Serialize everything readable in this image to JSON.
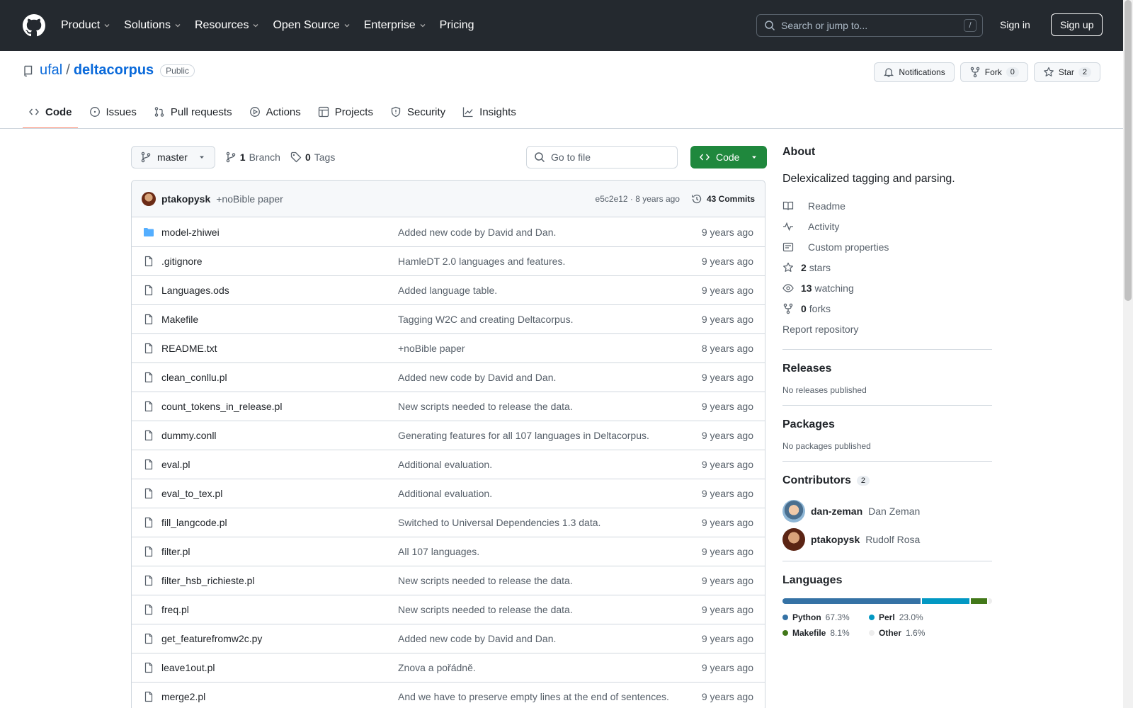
{
  "header": {
    "nav": [
      "Product",
      "Solutions",
      "Resources",
      "Open Source",
      "Enterprise",
      "Pricing"
    ],
    "search_placeholder": "Search or jump to...",
    "search_shortcut": "/",
    "signin": "Sign in",
    "signup": "Sign up"
  },
  "repo": {
    "owner": "ufal",
    "separator": "/",
    "name": "deltacorpus",
    "visibility": "Public",
    "notifications_label": "Notifications",
    "fork_label": "Fork",
    "fork_count": "0",
    "star_label": "Star",
    "star_count": "2"
  },
  "tabs": [
    "Code",
    "Issues",
    "Pull requests",
    "Actions",
    "Projects",
    "Security",
    "Insights"
  ],
  "toolbar": {
    "branch": "master",
    "branch_count": "1",
    "branch_label": "Branch",
    "tag_count": "0",
    "tag_label": "Tags",
    "goto_placeholder": "Go to file",
    "code_label": "Code"
  },
  "latest_commit": {
    "author": "ptakopysk",
    "message": "+noBible paper",
    "sha_age": "e5c2e12 · 8 years ago",
    "commits": "43 Commits"
  },
  "files": [
    {
      "name": "model-zhiwei",
      "type": "dir",
      "message": "Added new code by David and Dan.",
      "age": "9 years ago"
    },
    {
      "name": ".gitignore",
      "type": "file",
      "message": "HamleDT 2.0 languages and features.",
      "age": "9 years ago"
    },
    {
      "name": "Languages.ods",
      "type": "file",
      "message": "Added language table.",
      "age": "9 years ago"
    },
    {
      "name": "Makefile",
      "type": "file",
      "message": "Tagging W2C and creating Deltacorpus.",
      "age": "9 years ago"
    },
    {
      "name": "README.txt",
      "type": "file",
      "message": "+noBible paper",
      "age": "8 years ago"
    },
    {
      "name": "clean_conllu.pl",
      "type": "file",
      "message": "Added new code by David and Dan.",
      "age": "9 years ago"
    },
    {
      "name": "count_tokens_in_release.pl",
      "type": "file",
      "message": "New scripts needed to release the data.",
      "age": "9 years ago"
    },
    {
      "name": "dummy.conll",
      "type": "file",
      "message": "Generating features for all 107 languages in Deltacorpus.",
      "age": "9 years ago"
    },
    {
      "name": "eval.pl",
      "type": "file",
      "message": "Additional evaluation.",
      "age": "9 years ago"
    },
    {
      "name": "eval_to_tex.pl",
      "type": "file",
      "message": "Additional evaluation.",
      "age": "9 years ago"
    },
    {
      "name": "fill_langcode.pl",
      "type": "file",
      "message": "Switched to Universal Dependencies 1.3 data.",
      "age": "9 years ago"
    },
    {
      "name": "filter.pl",
      "type": "file",
      "message": "All 107 languages.",
      "age": "9 years ago"
    },
    {
      "name": "filter_hsb_richieste.pl",
      "type": "file",
      "message": "New scripts needed to release the data.",
      "age": "9 years ago"
    },
    {
      "name": "freq.pl",
      "type": "file",
      "message": "New scripts needed to release the data.",
      "age": "9 years ago"
    },
    {
      "name": "get_featurefromw2c.py",
      "type": "file",
      "message": "Added new code by David and Dan.",
      "age": "9 years ago"
    },
    {
      "name": "leave1out.pl",
      "type": "file",
      "message": "Znova a pořádně.",
      "age": "9 years ago"
    },
    {
      "name": "merge2.pl",
      "type": "file",
      "message": "And we have to preserve empty lines at the end of sentences.",
      "age": "9 years ago"
    }
  ],
  "about": {
    "title": "About",
    "description": "Delexicalized tagging and parsing.",
    "links": [
      {
        "icon": "book-icon",
        "bold": "",
        "text": "Readme"
      },
      {
        "icon": "pulse-icon",
        "bold": "",
        "text": "Activity"
      },
      {
        "icon": "note-icon",
        "bold": "",
        "text": "Custom properties"
      },
      {
        "icon": "star-icon",
        "bold": "2",
        "text": "stars"
      },
      {
        "icon": "eye-icon",
        "bold": "13",
        "text": "watching"
      },
      {
        "icon": "fork-icon",
        "bold": "0",
        "text": "forks"
      }
    ],
    "report": "Report repository"
  },
  "releases": {
    "title": "Releases",
    "note": "No releases published"
  },
  "packages": {
    "title": "Packages",
    "note": "No packages published"
  },
  "contributors": {
    "title": "Contributors",
    "count": "2",
    "people": [
      {
        "login": "dan-zeman",
        "name": "Dan Zeman"
      },
      {
        "login": "ptakopysk",
        "name": "Rudolf Rosa"
      }
    ]
  },
  "languages": {
    "title": "Languages",
    "items": [
      {
        "name": "Python",
        "percent": "67.3%",
        "value": 67.3,
        "color": "#3572A5"
      },
      {
        "name": "Perl",
        "percent": "23.0%",
        "value": 23.0,
        "color": "#0298c3"
      },
      {
        "name": "Makefile",
        "percent": "8.1%",
        "value": 8.1,
        "color": "#427819"
      },
      {
        "name": "Other",
        "percent": "1.6%",
        "value": 1.6,
        "color": "#ededed"
      }
    ]
  }
}
